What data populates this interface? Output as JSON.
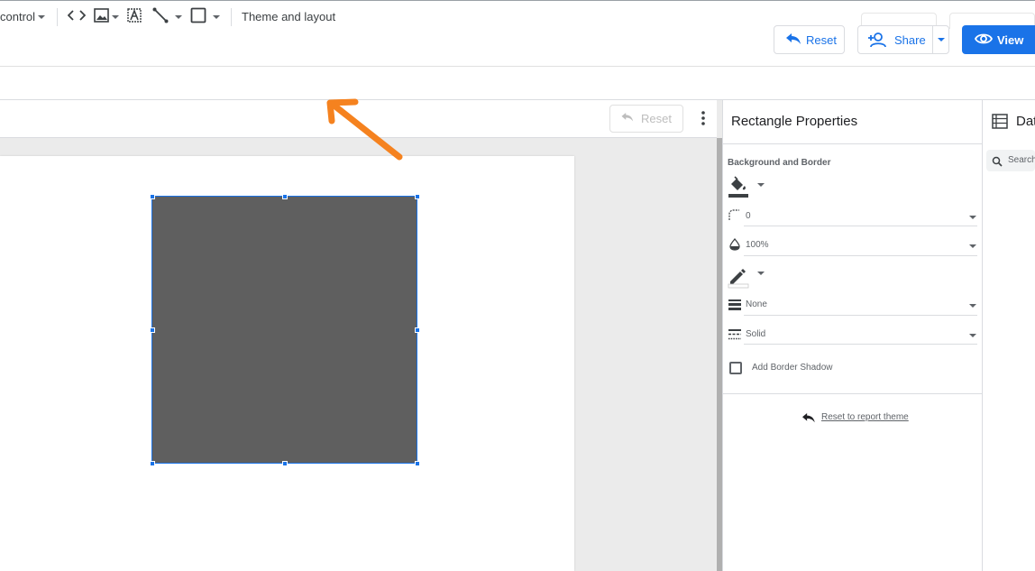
{
  "header": {
    "reset_label": "Reset",
    "share_label": "Share",
    "view_label": "View"
  },
  "toolbar": {
    "control_label": "control",
    "theme_layout_label": "Theme and layout"
  },
  "canvas": {
    "reset_label": "Reset"
  },
  "properties": {
    "title": "Rectangle Properties",
    "section_label": "Background and Border",
    "border_radius_value": "0",
    "opacity_value": "100%",
    "border_weight_value": "None",
    "border_style_value": "Solid",
    "shadow_label": "Add Border Shadow",
    "reset_theme_label": "Reset to report theme"
  },
  "data_panel": {
    "title": "Dat",
    "search_placeholder": "Search"
  },
  "colors": {
    "accent": "#1a73e8",
    "rectangle_fill": "#5f5f5f",
    "annotation_arrow": "#f5821f"
  }
}
